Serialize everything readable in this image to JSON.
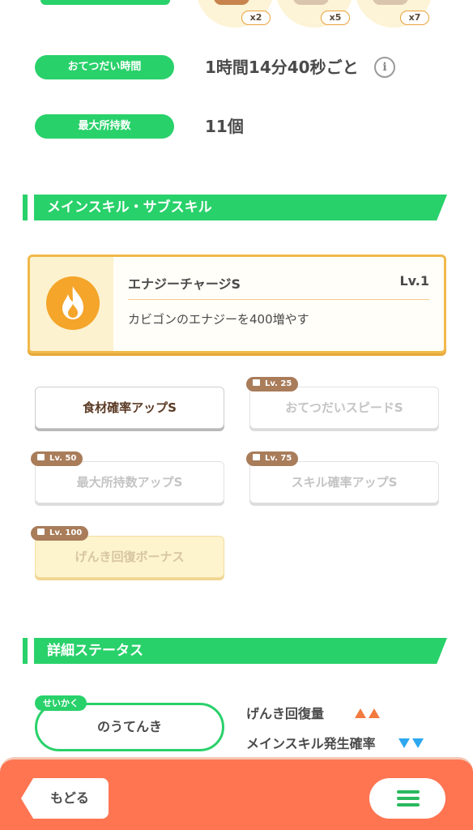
{
  "ingredients": [
    {
      "count": "x2"
    },
    {
      "count": "x5"
    },
    {
      "count": "x7"
    }
  ],
  "info": {
    "help_time_label": "おてつだい時間",
    "help_time_value": "1時間14分40秒ごと",
    "info_icon_glyph": "i",
    "max_carry_label": "最大所持数",
    "max_carry_value": "11個"
  },
  "skills_section": {
    "title": "メインスキル・サブスキル",
    "main_skill": {
      "name": "エナジーチャージS",
      "level": "Lv.1",
      "description": "カビゴンのエナジーを400増やす",
      "icon": "fire-icon"
    },
    "sub_skills": [
      {
        "label": "食材確率アップS",
        "lock": ""
      },
      {
        "label": "おてつだいスピードS",
        "lock": "Lv. 25"
      },
      {
        "label": "最大所持数アップS",
        "lock": "Lv. 50"
      },
      {
        "label": "スキル確率アップS",
        "lock": "Lv. 75"
      },
      {
        "label": "げんき回復ボーナス",
        "lock": "Lv. 100"
      }
    ]
  },
  "status_section": {
    "title": "詳細ステータス",
    "nature_tag": "せいかく",
    "nature_value": "のうてんき",
    "up_stat": "げんき回復量",
    "down_stat": "メインスキル発生確率"
  },
  "bottom_bar": {
    "back_label": "もどる",
    "menu_icon": "hamburger-menu-icon"
  },
  "colors": {
    "accent_green": "#29d16a",
    "bottom_bar": "#ff7552",
    "up_arrow": "#f27a3e",
    "down_arrow": "#2da8ef"
  }
}
